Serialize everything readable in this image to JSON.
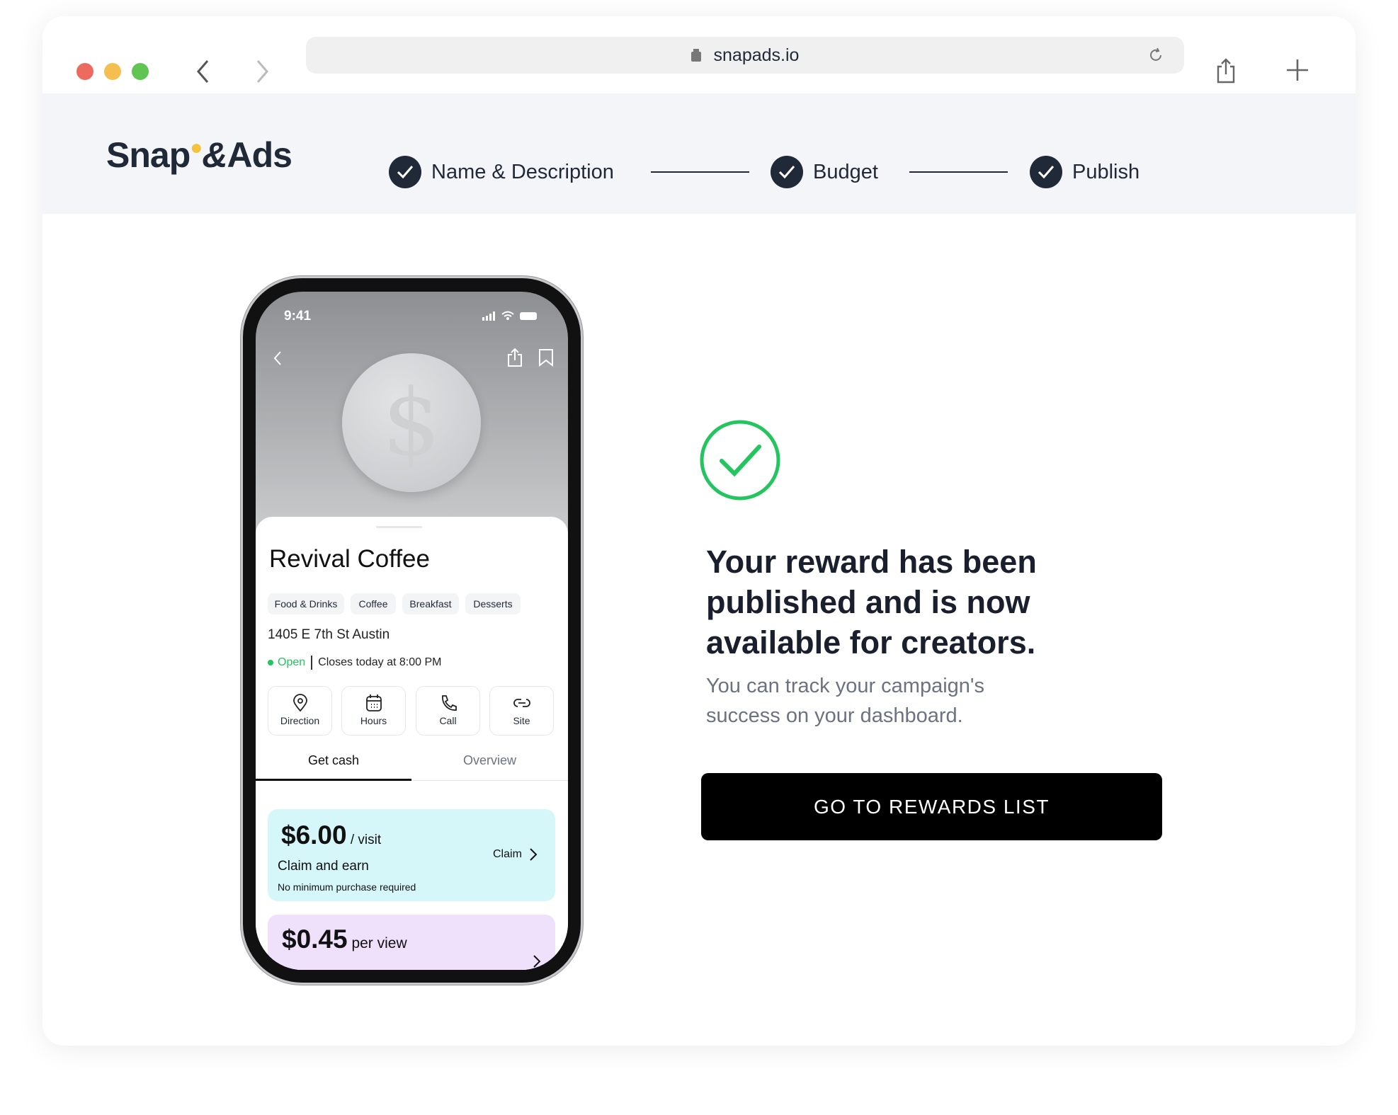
{
  "browser": {
    "url": "snapads.io",
    "traffic_lights": [
      "#ed6a5e",
      "#f5bf4f",
      "#61c554"
    ]
  },
  "header": {
    "logo": {
      "left": "Snap",
      "right": "Ads"
    },
    "steps": [
      {
        "label": "Name & Description",
        "status": "complete"
      },
      {
        "label": "Budget",
        "status": "complete"
      },
      {
        "label": "Publish",
        "status": "complete"
      }
    ]
  },
  "phone": {
    "status_time": "9:41",
    "business": {
      "name": "Revival Coffee",
      "tags": [
        "Food & Drinks",
        "Coffee",
        "Breakfast",
        "Desserts"
      ],
      "address": "1405 E 7th St Austin",
      "open_status": "Open",
      "hours_text": "Closes today at 8:00 PM"
    },
    "actions": [
      {
        "label": "Direction",
        "icon": "map-pin-icon"
      },
      {
        "label": "Hours",
        "icon": "calendar-icon"
      },
      {
        "label": "Call",
        "icon": "phone-icon"
      },
      {
        "label": "Site",
        "icon": "link-icon"
      }
    ],
    "tabs": [
      {
        "label": "Get cash",
        "active": true
      },
      {
        "label": "Overview",
        "active": false
      }
    ],
    "rewards": [
      {
        "amount": "$6.00",
        "unit": "/ visit",
        "title": "Claim and earn",
        "note": "No minimum purchase required",
        "cta": "Claim",
        "color": "#d6f7fa"
      },
      {
        "amount": "$0.45",
        "unit": "per view",
        "color": "#efe0fc"
      }
    ]
  },
  "success": {
    "heading_lines": [
      "Your reward has been",
      "published and is now",
      "available for creators."
    ],
    "sub_lines": [
      "You can track your campaign's",
      "success on your dashboard."
    ],
    "button": "GO TO REWARDS LIST",
    "accent": "#22c55e"
  }
}
